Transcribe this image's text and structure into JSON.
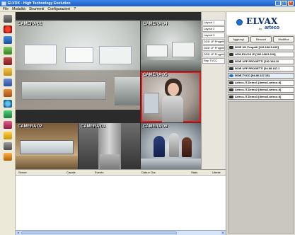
{
  "window": {
    "title": "ELVOX - High Technology Evolution"
  },
  "menu": [
    {
      "label": "File"
    },
    {
      "label": "Modalità"
    },
    {
      "label": "Strumenti"
    },
    {
      "label": "Configurazioni"
    },
    {
      "label": "?"
    }
  ],
  "cameras": [
    {
      "label": "CAMERA 01"
    },
    {
      "label": "CAMERA 04"
    },
    {
      "label": "CAMERA 05"
    },
    {
      "label": "CAMERA 02"
    },
    {
      "label": "CAMERA 03"
    },
    {
      "label": "CAMERA 06"
    }
  ],
  "layouts": [
    {
      "label": "Layout 1"
    },
    {
      "label": "Layout 2"
    },
    {
      "label": "Layout 3"
    },
    {
      "label": "DDD LP Progetti"
    },
    {
      "label": "DDD LP Progetti"
    },
    {
      "label": "DDD LP Progetti"
    },
    {
      "label": "Rep TVCC"
    }
  ],
  "brand": {
    "name": "ELVAX",
    "by": "by",
    "sub": "arteco"
  },
  "panel_buttons": [
    {
      "label": "Aggiungi"
    },
    {
      "label": "Rimuovi"
    },
    {
      "label": "Modifica"
    }
  ],
  "devices": [
    {
      "label": "500E UK Progetti [192.168.5.226]"
    },
    {
      "label": "4000 ELVOX IP [192.168.5.229]"
    },
    {
      "label": "500E UFF PROGETTI [192.168.10"
    },
    {
      "label": "500E UFF PROGETTI [94.88.187.2"
    },
    {
      "label": "500E-TVCC [94.80.127.15]"
    },
    {
      "label": "Arteco-IT-Demo1 [demo1.arteco.it]"
    },
    {
      "label": "Arteco-IT-Demo2 [demo2.arteco.it]"
    },
    {
      "label": "Arteco-IT-Demo3 [demo3.arteco.it]"
    }
  ],
  "event_columns": [
    {
      "label": "Server"
    },
    {
      "label": "Canale"
    },
    {
      "label": "Evento"
    },
    {
      "label": "Data e Ora"
    },
    {
      "label": "Stato"
    },
    {
      "label": "Utente"
    }
  ],
  "colors": {
    "selected_camera_border": "#e81818",
    "titlebar": "#1c5dc8",
    "taskbar_blue": "#1a5fc2"
  }
}
